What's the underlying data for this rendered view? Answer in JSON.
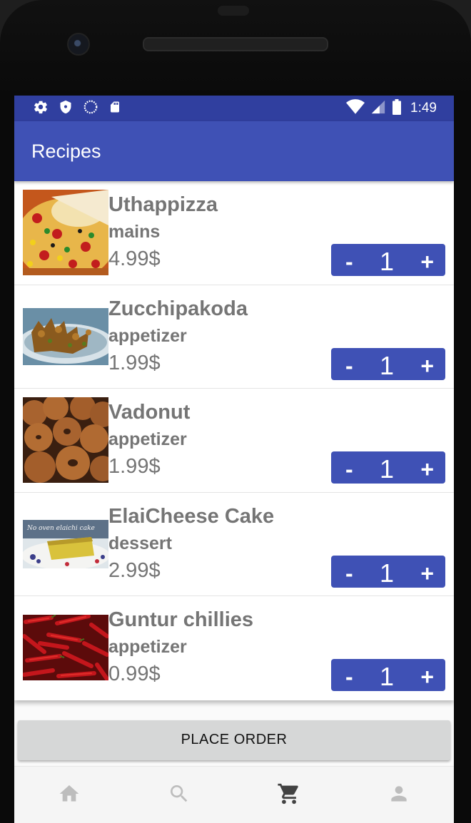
{
  "status_bar": {
    "time": "1:49"
  },
  "app_bar": {
    "title": "Recipes"
  },
  "recipes": [
    {
      "name": "Uthappizza",
      "category": "mains",
      "price": "4.99$",
      "quantity": "1"
    },
    {
      "name": "Zucchipakoda",
      "category": "appetizer",
      "price": "1.99$",
      "quantity": "1"
    },
    {
      "name": "Vadonut",
      "category": "appetizer",
      "price": "1.99$",
      "quantity": "1"
    },
    {
      "name": "ElaiCheese Cake",
      "category": "dessert",
      "price": "2.99$",
      "quantity": "1"
    },
    {
      "name": "Guntur chillies",
      "category": "appetizer",
      "price": "0.99$",
      "quantity": "1"
    }
  ],
  "stepper": {
    "minus": "-",
    "plus": "+"
  },
  "place_order": {
    "label": "PLACE ORDER"
  },
  "cake_image_caption": "No oven elaichi cake",
  "bottom_nav": {
    "items": [
      {
        "icon": "home-icon",
        "active": false
      },
      {
        "icon": "search-icon",
        "active": false
      },
      {
        "icon": "cart-icon",
        "active": true
      },
      {
        "icon": "person-icon",
        "active": false
      }
    ]
  },
  "colors": {
    "primary": "#3f51b5",
    "primary_dark": "#303f9f",
    "text_secondary": "#757575",
    "button_gray": "#d6d7d7"
  }
}
